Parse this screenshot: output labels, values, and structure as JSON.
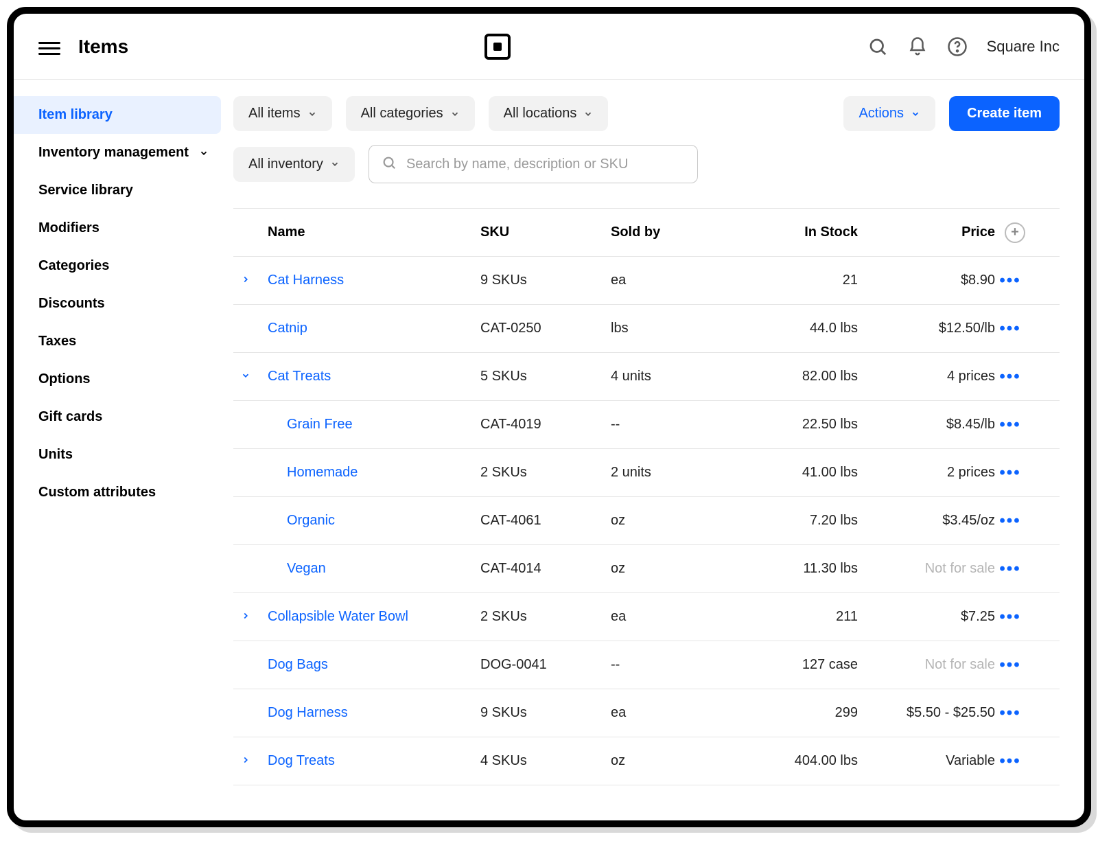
{
  "header": {
    "page_title": "Items",
    "org_name": "Square Inc"
  },
  "sidebar": {
    "items": [
      {
        "label": "Item library",
        "active": true
      },
      {
        "label": "Inventory management",
        "expandable": true
      },
      {
        "label": "Service library"
      },
      {
        "label": "Modifiers"
      },
      {
        "label": "Categories"
      },
      {
        "label": "Discounts"
      },
      {
        "label": "Taxes"
      },
      {
        "label": "Options"
      },
      {
        "label": "Gift cards"
      },
      {
        "label": "Units"
      },
      {
        "label": "Custom attributes"
      }
    ]
  },
  "filters": {
    "all_items": "All items",
    "all_categories": "All categories",
    "all_locations": "All locations",
    "all_inventory": "All inventory",
    "actions": "Actions",
    "create_item": "Create item",
    "search_placeholder": "Search by name, description or SKU"
  },
  "table": {
    "columns": {
      "name": "Name",
      "sku": "SKU",
      "sold_by": "Sold by",
      "in_stock": "In Stock",
      "price": "Price"
    },
    "rows": [
      {
        "caret": "right",
        "name": "Cat Harness",
        "sku": "9 SKUs",
        "sold_by": "ea",
        "in_stock": "21",
        "price": "$8.90"
      },
      {
        "caret": "",
        "name": "Catnip",
        "sku": "CAT-0250",
        "sold_by": "lbs",
        "in_stock": "44.0 lbs",
        "price": "$12.50/lb"
      },
      {
        "caret": "down",
        "name": "Cat Treats",
        "sku": "5 SKUs",
        "sold_by": "4 units",
        "in_stock": "82.00 lbs",
        "price": "4 prices"
      },
      {
        "caret": "",
        "child": true,
        "name": "Grain Free",
        "sku": "CAT-4019",
        "sold_by": "--",
        "in_stock": "22.50 lbs",
        "price": "$8.45/lb"
      },
      {
        "caret": "",
        "child": true,
        "name": "Homemade",
        "sku": "2 SKUs",
        "sold_by": "2 units",
        "in_stock": "41.00 lbs",
        "price": "2 prices"
      },
      {
        "caret": "",
        "child": true,
        "name": "Organic",
        "sku": "CAT-4061",
        "sold_by": "oz",
        "in_stock": "7.20 lbs",
        "price": "$3.45/oz"
      },
      {
        "caret": "",
        "child": true,
        "name": "Vegan",
        "sku": "CAT-4014",
        "sold_by": "oz",
        "in_stock": "11.30 lbs",
        "price": "Not for sale",
        "price_muted": true
      },
      {
        "caret": "right",
        "name": "Collapsible Water Bowl",
        "sku": "2 SKUs",
        "sold_by": "ea",
        "in_stock": "211",
        "price": "$7.25"
      },
      {
        "caret": "",
        "name": "Dog Bags",
        "sku": "DOG-0041",
        "sold_by": "--",
        "in_stock": "127 case",
        "price": "Not for sale",
        "price_muted": true
      },
      {
        "caret": "",
        "name": "Dog Harness",
        "sku": "9 SKUs",
        "sold_by": "ea",
        "in_stock": "299",
        "price": "$5.50 - $25.50"
      },
      {
        "caret": "right",
        "name": "Dog Treats",
        "sku": "4 SKUs",
        "sold_by": "oz",
        "in_stock": "404.00 lbs",
        "price": "Variable"
      }
    ]
  }
}
